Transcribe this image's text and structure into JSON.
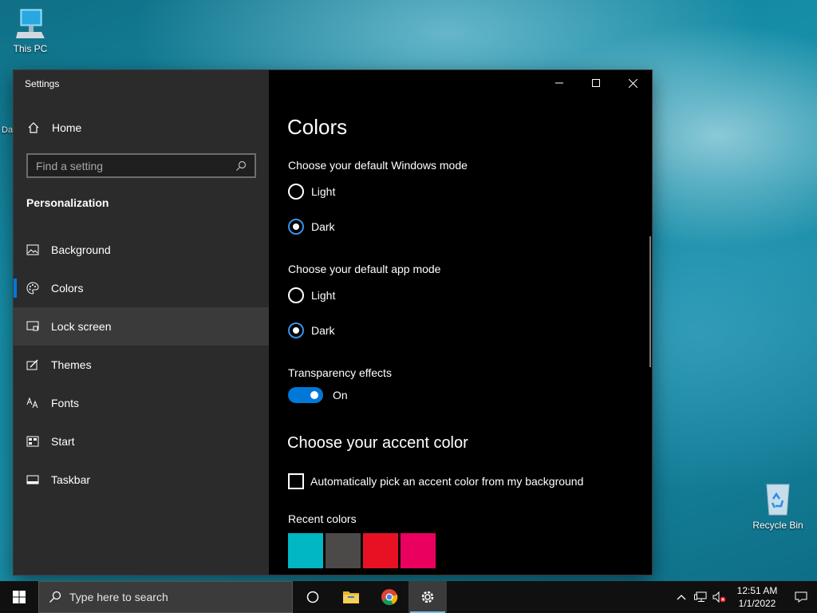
{
  "desktop": {
    "this_pc_label": "This PC",
    "partial_label": "Da",
    "recycle_bin_label": "Recycle Bin"
  },
  "window": {
    "title": "Settings",
    "accent_color": "#0078d7"
  },
  "sidebar": {
    "home_label": "Home",
    "search_placeholder": "Find a setting",
    "section_title": "Personalization",
    "items": [
      {
        "label": "Background",
        "icon": "picture-icon"
      },
      {
        "label": "Colors",
        "icon": "palette-icon",
        "selected": true
      },
      {
        "label": "Lock screen",
        "icon": "lock-screen-icon",
        "hover": true
      },
      {
        "label": "Themes",
        "icon": "themes-icon"
      },
      {
        "label": "Fonts",
        "icon": "fonts-icon"
      },
      {
        "label": "Start",
        "icon": "start-icon"
      },
      {
        "label": "Taskbar",
        "icon": "taskbar-icon"
      }
    ]
  },
  "main": {
    "title": "Colors",
    "windows_mode": {
      "heading": "Choose your default Windows mode",
      "options": [
        "Light",
        "Dark"
      ],
      "selected": "Dark"
    },
    "app_mode": {
      "heading": "Choose your default app mode",
      "options": [
        "Light",
        "Dark"
      ],
      "selected": "Dark"
    },
    "transparency": {
      "heading": "Transparency effects",
      "state": "On"
    },
    "accent_heading": "Choose your accent color",
    "auto_pick_label": "Automatically pick an accent color from my background",
    "recent_colors_label": "Recent colors",
    "recent_colors": [
      "#00b7c3",
      "#4c4a48",
      "#e81123",
      "#ea005e"
    ]
  },
  "taskbar": {
    "search_placeholder": "Type here to search",
    "time": "12:51 AM",
    "date": "1/1/2022"
  }
}
